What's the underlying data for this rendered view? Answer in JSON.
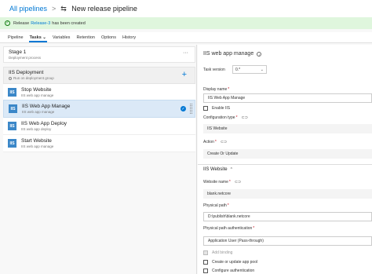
{
  "header": {
    "breadcrumb_root": "All pipelines",
    "separator": ">",
    "title": "New release pipeline"
  },
  "banner": {
    "prefix": "Release",
    "link": "Release-3",
    "suffix": "has been created"
  },
  "tabs": [
    {
      "label": "Pipeline"
    },
    {
      "label": "Tasks ⌄"
    },
    {
      "label": "Variables"
    },
    {
      "label": "Retention"
    },
    {
      "label": "Options"
    },
    {
      "label": "History"
    }
  ],
  "stage": {
    "name": "Stage 1",
    "subtitle": "Deployment process"
  },
  "job": {
    "name": "IIS Deployment",
    "subtitle": "Run on deployment group"
  },
  "tasks": [
    {
      "name": "Stop Website",
      "subtitle": "IIS web app manage",
      "icon": "IIS"
    },
    {
      "name": "IIS Web App Manage",
      "subtitle": "IIS web app manage",
      "icon": "IIS"
    },
    {
      "name": "IIS Web App Deploy",
      "subtitle": "IIS web app deploy",
      "icon": "IIS"
    },
    {
      "name": "Start Website",
      "subtitle": "IIS web app manage",
      "icon": "IIS"
    }
  ],
  "detail": {
    "title": "IIS web app manage",
    "task_version_label": "Task version",
    "task_version_value": "0.*",
    "display_name_label": "Display name",
    "display_name_value": "IIS Web App Manage",
    "enable_iis_label": "Enable IIS",
    "configuration_type_label": "Configuration type",
    "configuration_type_value": "IIS Website",
    "action_label": "Action",
    "action_value": "Create Or Update",
    "section_title": "IIS Website",
    "website_name_label": "Website name",
    "website_name_value": "blank.netcore",
    "physical_path_label": "Physical path",
    "physical_path_value": "D:\\publish\\blank.netcore",
    "physical_path_auth_label": "Physical path authentication",
    "physical_path_auth_value": "Application User (Pass-through)",
    "add_binding_label": "Add binding",
    "create_app_pool_label": "Create or update app pool",
    "configure_auth_label": "Configure authentication"
  },
  "colors": {
    "accent": "#0078d4",
    "success_bg": "#dff6dd",
    "task_icon": "#3b87c8",
    "selected_row": "#dbe9f7"
  }
}
